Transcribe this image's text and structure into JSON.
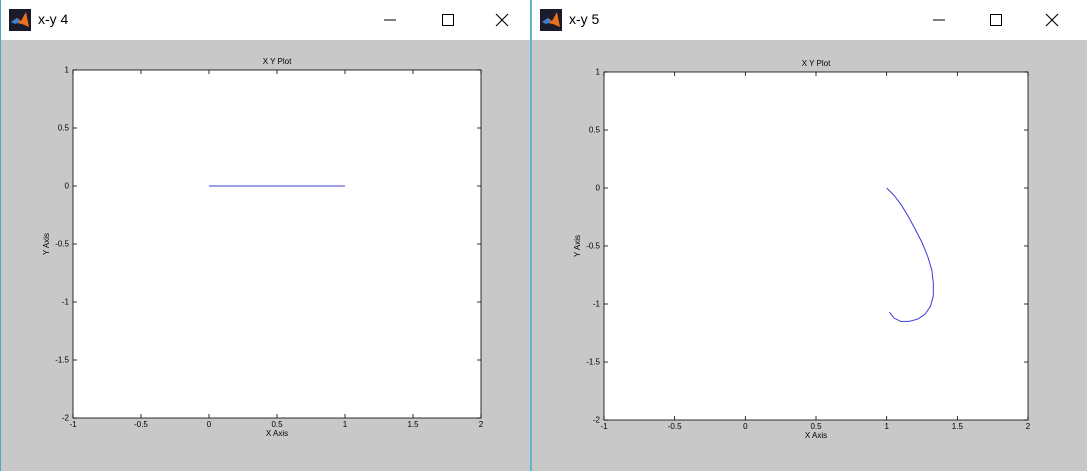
{
  "windows": [
    {
      "id": "left",
      "title": "x-y 4",
      "chart_data": {
        "type": "line",
        "title": "X Y Plot",
        "xlabel": "X Axis",
        "ylabel": "Y Axis",
        "xlim": [
          -1,
          2
        ],
        "ylim": [
          -2,
          1
        ],
        "xticks": [
          -1,
          -0.5,
          0,
          0.5,
          1,
          1.5,
          2
        ],
        "xtick_labels": [
          "-1",
          "-0.5",
          "0",
          "0.5",
          "1",
          "1.5",
          "2"
        ],
        "yticks": [
          1,
          0.5,
          0,
          -0.5,
          -1,
          -1.5,
          -2
        ],
        "ytick_labels": [
          "1",
          "0.5",
          "0",
          "-0.5",
          "-1",
          "-1.5",
          "-2"
        ],
        "grid": false,
        "line_color": "#3b3bd6",
        "series": [
          {
            "x": [
              0,
              1
            ],
            "y": [
              0,
              0
            ]
          }
        ]
      }
    },
    {
      "id": "right",
      "title": "x-y 5",
      "chart_data": {
        "type": "line",
        "title": "X Y Plot",
        "xlabel": "X Axis",
        "ylabel": "Y Axis",
        "xlim": [
          -1,
          2
        ],
        "ylim": [
          -2,
          1
        ],
        "xticks": [
          -1,
          -0.5,
          0,
          0.5,
          1,
          1.5,
          2
        ],
        "xtick_labels": [
          "-1",
          "-0.5",
          "0",
          "0.5",
          "1",
          "1.5",
          "2"
        ],
        "yticks": [
          1,
          0.5,
          0,
          -0.5,
          -1,
          -1.5,
          -2
        ],
        "ytick_labels": [
          "1",
          "0.5",
          "0",
          "-0.5",
          "-1",
          "-1.5",
          "-2"
        ],
        "grid": false,
        "line_color": "#3b3bd6",
        "series": [
          {
            "x": [
              1.0,
              1.05,
              1.1,
              1.15,
              1.2,
              1.25,
              1.29,
              1.32,
              1.33,
              1.33,
              1.31,
              1.27,
              1.22,
              1.16,
              1.1,
              1.05,
              1.02
            ],
            "y": [
              0.0,
              -0.06,
              -0.14,
              -0.24,
              -0.35,
              -0.47,
              -0.59,
              -0.71,
              -0.82,
              -0.93,
              -1.02,
              -1.09,
              -1.13,
              -1.15,
              -1.15,
              -1.12,
              -1.07
            ]
          }
        ]
      }
    }
  ]
}
